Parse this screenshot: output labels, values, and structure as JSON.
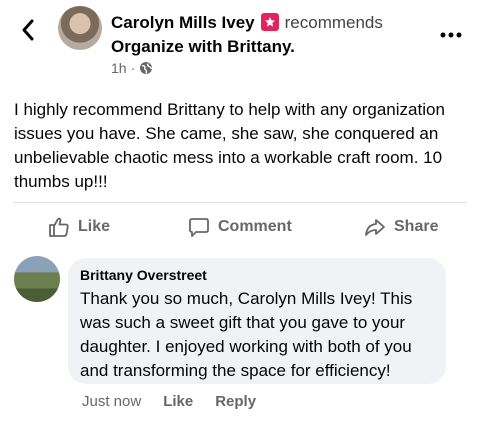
{
  "post": {
    "author": "Carolyn Mills Ivey",
    "action_word": "recommends",
    "page_name": "Organize with Brittany.",
    "time": "1h",
    "text": "I highly recommend Brittany to help with any organization issues you have. She came, she saw, she conquered an unbelievable chaotic mess into a workable craft room. 10 thumbs up!!!"
  },
  "actions": {
    "like": "Like",
    "comment": "Comment",
    "share": "Share"
  },
  "comment": {
    "author": "Brittany Overstreet",
    "text": "Thank you so much, Carolyn Mills Ivey! This was such a sweet gift that you gave to your daughter. I enjoyed working with both of you and transforming the space for efficiency!",
    "time": "Just now",
    "like": "Like",
    "reply": "Reply"
  },
  "icons": {
    "back": "chevron-left-icon",
    "more": "more-dots-icon",
    "badge": "recommendation-star-icon",
    "globe": "globe-icon",
    "like": "thumbs-up-icon",
    "comment": "speech-bubble-icon",
    "share": "share-arrow-icon"
  },
  "colors": {
    "badge": "#e0245e",
    "secondary_text": "#65676b",
    "bubble": "#f0f2f5"
  }
}
